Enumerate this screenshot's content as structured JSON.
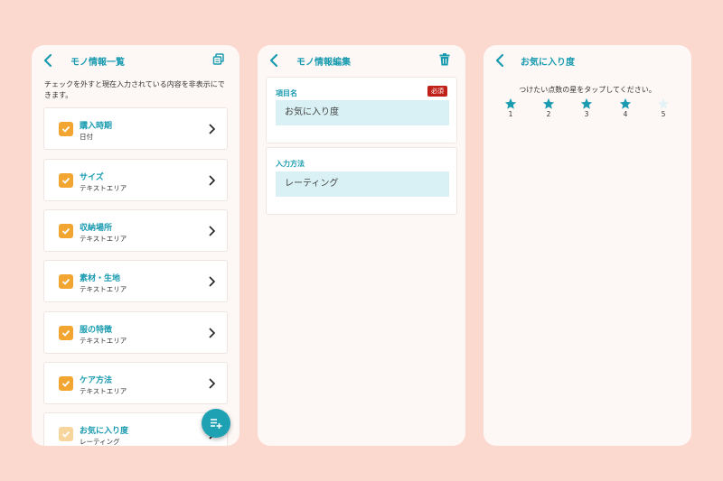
{
  "list_screen": {
    "title": "モノ情報一覧",
    "note": "チェックを外すと現在入力されている内容を非表示にできます。",
    "items": [
      {
        "label": "購入時期",
        "sub": "日付",
        "checked": true
      },
      {
        "label": "サイズ",
        "sub": "テキストエリア",
        "checked": true
      },
      {
        "label": "収納場所",
        "sub": "テキストエリア",
        "checked": true
      },
      {
        "label": "素材・生地",
        "sub": "テキストエリア",
        "checked": true
      },
      {
        "label": "服の特徴",
        "sub": "テキストエリア",
        "checked": true
      },
      {
        "label": "ケア方法",
        "sub": "テキストエリア",
        "checked": true
      },
      {
        "label": "お気に入り度",
        "sub": "レーティング",
        "checked": true
      }
    ],
    "icons": {
      "back": "back-chevron-icon",
      "action": "copy-icon",
      "fab": "add-list-icon"
    }
  },
  "edit_screen": {
    "title": "モノ情報編集",
    "name_label": "項目名",
    "required_badge": "必須",
    "name_value": "お気に入り度",
    "method_label": "入力方法",
    "method_value": "レーティング",
    "icons": {
      "back": "back-chevron-icon",
      "action": "trash-icon"
    }
  },
  "rating_screen": {
    "title": "お気に入り度",
    "instruction": "つけたい点数の星をタップしてください。",
    "stars": [
      "1",
      "2",
      "3",
      "4",
      "5"
    ],
    "rating_value": 4,
    "rating_max": 5
  },
  "colors": {
    "accent": "#1a9bb0",
    "background": "#fcd9cf",
    "checkbox": "#f2a530",
    "required": "#c0201a",
    "field": "#d9f1f4"
  }
}
